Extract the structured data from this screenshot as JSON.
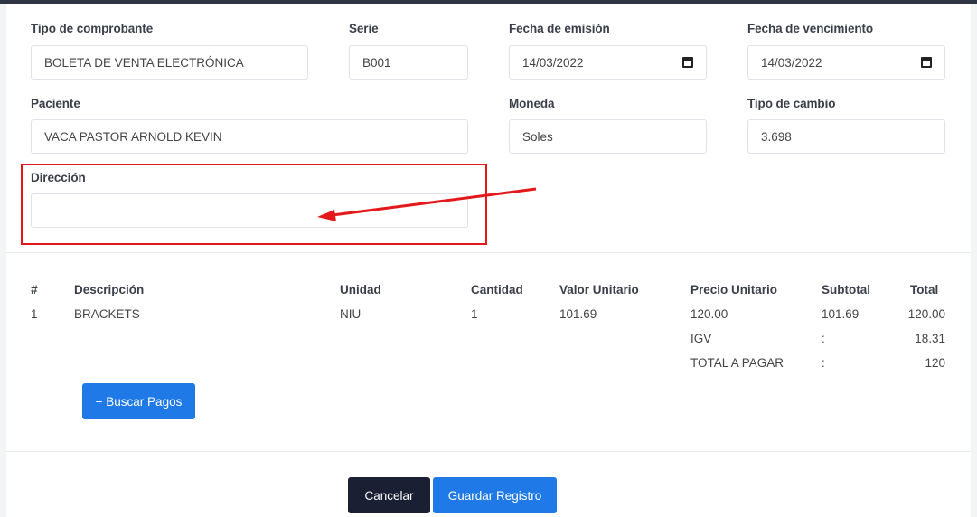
{
  "form": {
    "tipo_comprobante": {
      "label": "Tipo de comprobante",
      "value": "BOLETA DE VENTA ELECTRÓNICA"
    },
    "serie": {
      "label": "Serie",
      "value": "B001"
    },
    "fecha_emision": {
      "label": "Fecha de emisión",
      "value": "14/03/2022"
    },
    "fecha_vencimiento": {
      "label": "Fecha de vencimiento",
      "value": "14/03/2022"
    },
    "paciente": {
      "label": "Paciente",
      "value": "VACA PASTOR ARNOLD KEVIN"
    },
    "moneda": {
      "label": "Moneda",
      "value": "Soles"
    },
    "tipo_cambio": {
      "label": "Tipo de cambio",
      "value": "3.698"
    },
    "direccion": {
      "label": "Dirección",
      "value": ""
    }
  },
  "annotation": {
    "color": "#e3191b"
  },
  "table": {
    "headers": {
      "num": "#",
      "descripcion": "Descripción",
      "unidad": "Unidad",
      "cantidad": "Cantidad",
      "valor_unitario": "Valor Unitario",
      "precio_unitario": "Precio Unitario",
      "subtotal": "Subtotal",
      "total": "Total"
    },
    "rows": [
      {
        "num": "1",
        "descripcion": "BRACKETS",
        "unidad": "NIU",
        "cantidad": "1",
        "valor_unitario": "101.69",
        "precio_unitario": "120.00",
        "subtotal": "101.69",
        "total": "120.00"
      }
    ],
    "summary": {
      "igv_label": "IGV",
      "igv_sep": ":",
      "igv_value": "18.31",
      "total_label": "TOTAL A PAGAR",
      "total_sep": ":",
      "total_value": "120"
    }
  },
  "buttons": {
    "buscar_pagos": "+ Buscar Pagos",
    "cancelar": "Cancelar",
    "guardar": "Guardar Registro"
  },
  "colors": {
    "primary": "#1f7ae8",
    "dark": "#1a1f33",
    "highlight": "#e3191b"
  }
}
